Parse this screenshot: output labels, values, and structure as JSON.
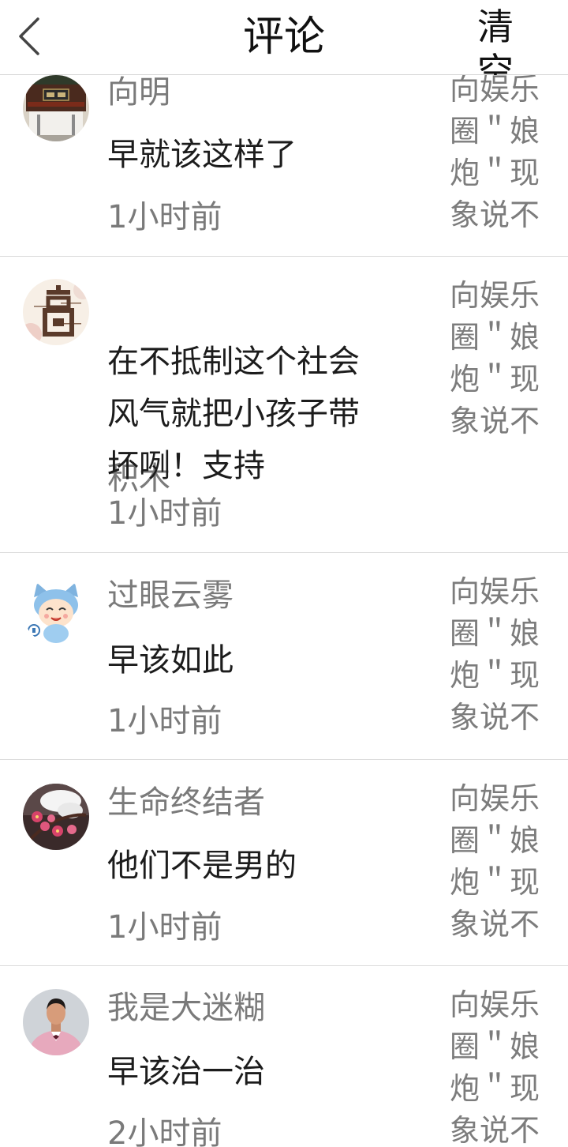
{
  "header": {
    "title": "评论",
    "clear_label": "清空"
  },
  "comments": [
    {
      "user": "向明",
      "content": "早就该这样了",
      "time": "1小时前",
      "ref_text": "向娱乐圈＂娘炮＂现象说不",
      "avatar": "building-avatar"
    },
    {
      "user": "积木",
      "content": "在不抵制这个社会风气就把小孩子带坏咧！支持",
      "time": "1小时前",
      "ref_text": "向娱乐圈＂娘炮＂现象说不",
      "avatar": "calligraphy-avatar"
    },
    {
      "user": "过眼云雾",
      "content": "早该如此",
      "time": "1小时前",
      "ref_text": "向娱乐圈＂娘炮＂现象说不",
      "avatar": "cartoon-cat-avatar"
    },
    {
      "user": "生命终结者",
      "content": "他们不是男的",
      "time": "1小时前",
      "ref_text": "向娱乐圈＂娘炮＂现象说不",
      "avatar": "plum-blossom-avatar"
    },
    {
      "user": "我是大迷糊",
      "content": "早该治一治",
      "time": "2小时前",
      "ref_text": "向娱乐圈＂娘炮＂现象说不",
      "avatar": "person-pink-suit-avatar"
    }
  ]
}
